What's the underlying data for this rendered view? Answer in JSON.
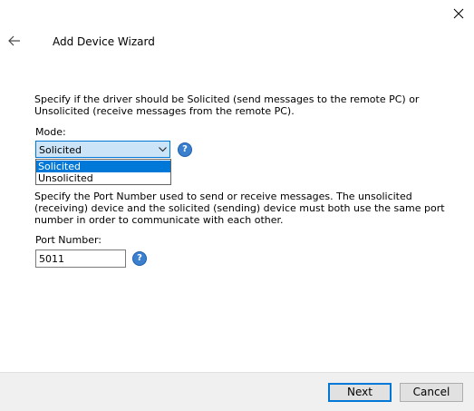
{
  "header": {
    "title": "Add Device Wizard",
    "back_icon": "back-arrow-icon",
    "close_icon": "close-icon"
  },
  "mode_section": {
    "description": "Specify if the driver should be Solicited (send messages to the remote PC) or Unsolicited (receive messages from the remote PC).",
    "label": "Mode:",
    "selected_value": "Solicited",
    "options": [
      "Solicited",
      "Unsolicited"
    ],
    "highlighted_option": "Solicited",
    "help_icon": "help-icon"
  },
  "port_section": {
    "description": "Specify the Port Number used to send or receive messages. The unsolicited (receiving) device and the solicited (sending) device must both use the same port number in order to communicate with each other.",
    "label": "Port Number:",
    "value": "5011",
    "help_icon": "help-icon"
  },
  "footer": {
    "next_label": "Next",
    "cancel_label": "Cancel"
  },
  "colors": {
    "accent": "#0078d7",
    "help_icon": "#3b7fcf",
    "footer_bg": "#f0f0f0"
  }
}
